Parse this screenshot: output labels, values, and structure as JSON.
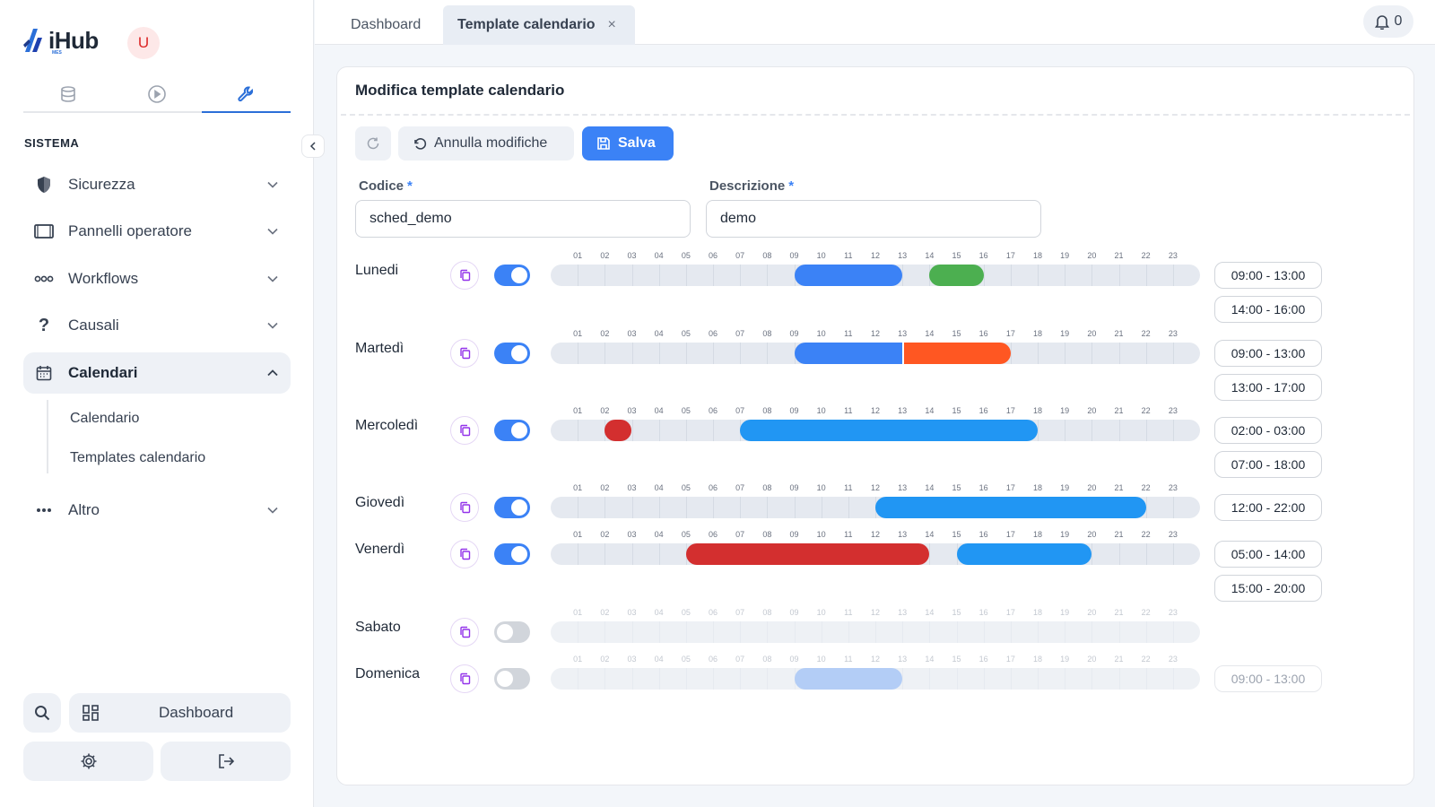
{
  "app": {
    "logo": "iHub",
    "logo_sub": "MES",
    "avatar_initial": "U"
  },
  "sidebar": {
    "section": "SISTEMA",
    "items": [
      {
        "label": "Sicurezza",
        "icon": "shield-icon"
      },
      {
        "label": "Pannelli operatore",
        "icon": "monitor-icon"
      },
      {
        "label": "Workflows",
        "icon": "workflow-dots-icon"
      },
      {
        "label": "Causali",
        "icon": "question-icon"
      },
      {
        "label": "Calendari",
        "icon": "calendar-icon"
      },
      {
        "label": "Altro",
        "icon": "more-icon"
      }
    ],
    "subitems": [
      "Calendario",
      "Templates calendario"
    ],
    "bottom": {
      "dashboard": "Dashboard"
    }
  },
  "tabs": {
    "dashboard": "Dashboard",
    "template": "Template calendario",
    "close": "×"
  },
  "notifications": {
    "count": "0"
  },
  "card": {
    "title": "Modifica template calendario",
    "undo_label": "Annulla modifiche",
    "save_label": "Salva",
    "codice_label": "Codice",
    "descrizione_label": "Descrizione",
    "required": "*",
    "codice_value": "sched_demo",
    "descrizione_value": "demo"
  },
  "hours": [
    "01",
    "02",
    "03",
    "04",
    "05",
    "06",
    "07",
    "08",
    "09",
    "10",
    "11",
    "12",
    "13",
    "14",
    "15",
    "16",
    "17",
    "18",
    "19",
    "20",
    "21",
    "22",
    "23"
  ],
  "colors": {
    "blue": "#3b82f6",
    "skyblue": "#2196f3",
    "green": "#4caf50",
    "orange": "#ff5722",
    "red": "#d32f2f",
    "lightblue": "#b3cdf6"
  },
  "days": [
    {
      "name": "Lunedi",
      "enabled": true,
      "segments": [
        {
          "start": 9,
          "end": 13,
          "color": "#3b82f6"
        },
        {
          "start": 14,
          "end": 16,
          "color": "#4caf50"
        }
      ],
      "ranges": [
        "09:00 - 13:00",
        "14:00 - 16:00"
      ]
    },
    {
      "name": "Martedì",
      "enabled": true,
      "segments": [
        {
          "start": 9,
          "end": 13,
          "color": "#3b82f6"
        },
        {
          "start": 13,
          "end": 17,
          "color": "#ff5722"
        }
      ],
      "ranges": [
        "09:00 - 13:00",
        "13:00 - 17:00"
      ]
    },
    {
      "name": "Mercoledì",
      "enabled": true,
      "segments": [
        {
          "start": 2,
          "end": 3,
          "color": "#d32f2f"
        },
        {
          "start": 7,
          "end": 18,
          "color": "#2196f3"
        }
      ],
      "ranges": [
        "02:00 - 03:00",
        "07:00 - 18:00"
      ]
    },
    {
      "name": "Giovedì",
      "enabled": true,
      "segments": [
        {
          "start": 12,
          "end": 22,
          "color": "#2196f3"
        }
      ],
      "ranges": [
        "12:00 - 22:00"
      ]
    },
    {
      "name": "Venerdì",
      "enabled": true,
      "segments": [
        {
          "start": 5,
          "end": 14,
          "color": "#d32f2f"
        },
        {
          "start": 15,
          "end": 20,
          "color": "#2196f3"
        }
      ],
      "ranges": [
        "05:00 - 14:00",
        "15:00 - 20:00"
      ]
    },
    {
      "name": "Sabato",
      "enabled": false,
      "segments": [],
      "ranges": []
    },
    {
      "name": "Domenica",
      "enabled": false,
      "segments": [
        {
          "start": 9,
          "end": 13,
          "color": "#b3cdf6"
        }
      ],
      "ranges": [
        "09:00 - 13:00"
      ]
    }
  ]
}
